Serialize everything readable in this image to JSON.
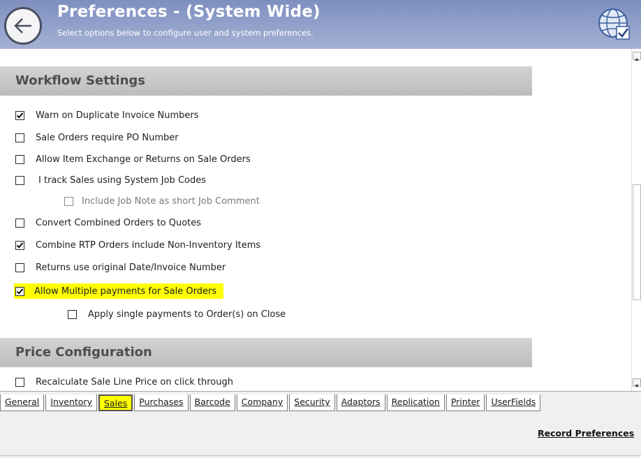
{
  "header": {
    "title": "Preferences - (System Wide)",
    "subtitle": "Select options below to configure user and system preferences."
  },
  "sections": {
    "workflow": "Workflow Settings",
    "price": "Price Configuration"
  },
  "options": [
    {
      "label": "Warn on Duplicate Invoice Numbers",
      "checked": true
    },
    {
      "label": "Sale Orders require PO Number",
      "checked": false
    },
    {
      "label": "Allow Item Exchange or Returns on Sale Orders",
      "checked": false
    },
    {
      "label": "I track Sales using System Job Codes",
      "checked": false
    },
    {
      "label": "Include Job Note as short Job Comment",
      "checked": false,
      "disabled": true
    },
    {
      "label": "Convert Combined Orders to Quotes",
      "checked": false
    },
    {
      "label": "Combine RTP Orders include Non-Inventory Items",
      "checked": true
    },
    {
      "label": "Returns use original Date/Invoice Number",
      "checked": false
    },
    {
      "label": "Allow Multiple payments for Sale Orders",
      "checked": true,
      "highlighted": true
    },
    {
      "label": "Apply single payments to Order(s) on Close",
      "checked": false
    },
    {
      "label": "Recalculate Sale Line Price on click through",
      "checked": false
    }
  ],
  "tabs": [
    "General",
    "Inventory",
    "Sales",
    "Purchases",
    "Barcode",
    "Company",
    "Security",
    "Adaptors",
    "Replication",
    "Printer",
    "UserFields"
  ],
  "active_tab": "Sales",
  "footer": {
    "record_label": "Record Preferences"
  },
  "colors": {
    "header_bg": "#93a2cb",
    "section_bg": "#c8c8c8",
    "highlight": "#ffff00"
  },
  "icons": {
    "back": "back-arrow-icon",
    "globe": "globe-check-icon",
    "check": "checkmark-icon"
  }
}
